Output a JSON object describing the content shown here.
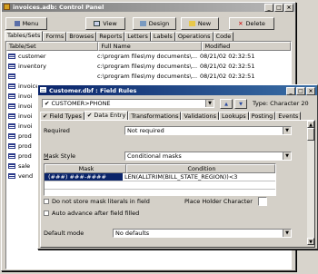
{
  "control_panel": {
    "title": "invoices.adb: Control Panel",
    "toolbar": {
      "menu": "Menu",
      "view": "View",
      "design": "Design",
      "new": "New",
      "delete": "Delete"
    },
    "tabs": [
      "Tables/Sets",
      "Forms",
      "Browses",
      "Reports",
      "Letters",
      "Labels",
      "Operations",
      "Code"
    ],
    "columns": [
      "Table/Set",
      "Full Name",
      "Modified"
    ],
    "rows": [
      {
        "name": "customer",
        "full": "c:\\program files\\my documents\\...",
        "mod": "08/21/02 02:32:51"
      },
      {
        "name": "inventory",
        "full": "c:\\program files\\my documents\\...",
        "mod": "08/21/02 02:32:51"
      },
      {
        "name": "",
        "full": "c:\\program files\\my documents\\...",
        "mod": "08/21/02 02:32:51"
      },
      {
        "name": "invoice",
        "full": "",
        "mod": ""
      },
      {
        "name": "invoi",
        "full": "",
        "mod": ""
      },
      {
        "name": "invoi",
        "full": "",
        "mod": ""
      },
      {
        "name": "invoi",
        "full": "",
        "mod": ""
      },
      {
        "name": "invoi",
        "full": "",
        "mod": ""
      },
      {
        "name": "prod",
        "full": "",
        "mod": ""
      },
      {
        "name": "prod",
        "full": "",
        "mod": ""
      },
      {
        "name": "prod",
        "full": "",
        "mod": ""
      },
      {
        "name": "sale",
        "full": "",
        "mod": ""
      },
      {
        "name": "vend",
        "full": "",
        "mod": ""
      }
    ]
  },
  "field_rules": {
    "title": "Customer.dbf : Field Rules",
    "field_select": "CUSTOMER>PHONE",
    "type_label": "Type: Character 20",
    "tabs": [
      "Field Types",
      "Data Entry",
      "Transformations",
      "Validations",
      "Lookups",
      "Posting",
      "Events"
    ],
    "required_label": "Required",
    "required_value": "Not required",
    "mask_style_label": "Mask Style",
    "mask_style_value": "Conditional masks",
    "mask_columns": [
      "Mask",
      "Condition"
    ],
    "mask_rows": [
      {
        "mask": "(###) ###-####",
        "condition": "LEN(ALLTRIM(BILL_STATE_REGION))<3"
      }
    ],
    "no_store_label": "Do not store mask literals in field",
    "placeholder_label": "Place Holder Character",
    "auto_advance_label": "Auto advance after field filled",
    "default_mode_label": "Default mode",
    "default_mode_value": "No defaults"
  }
}
